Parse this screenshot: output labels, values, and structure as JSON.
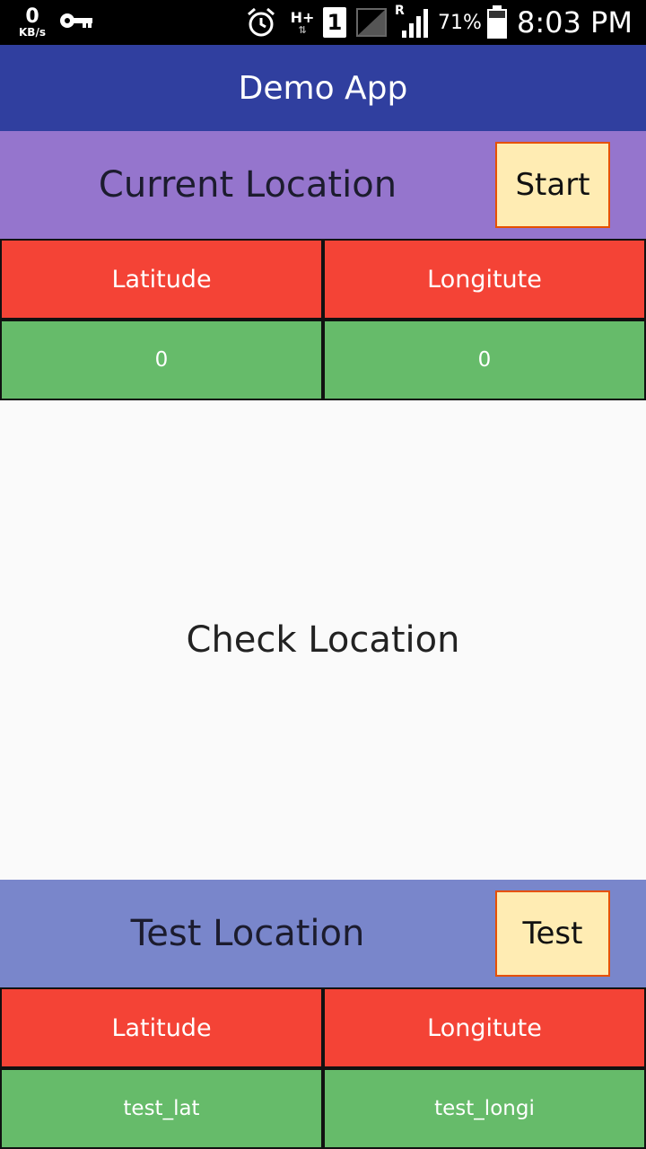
{
  "status_bar": {
    "data_rate_value": "0",
    "data_rate_unit": "KB/s",
    "network_type": "H+",
    "sim_slot": "1",
    "roaming": "R",
    "battery_percent": "71%",
    "time": "8:03 PM",
    "icons": [
      "vpn-key-icon",
      "alarm-icon",
      "sim-icon",
      "signal-icon",
      "battery-icon"
    ]
  },
  "app_bar": {
    "title": "Demo App",
    "color": "#303f9f"
  },
  "current_location": {
    "title": "Current Location",
    "button_label": "Start",
    "header_color": "#9575cd",
    "latitude_label": "Latitude",
    "longitude_label": "Longitute",
    "latitude_value": "0",
    "longitude_value": "0"
  },
  "check_location": {
    "label": "Check Location"
  },
  "test_location": {
    "title": "Test Location",
    "button_label": "Test",
    "header_color": "#7986cb",
    "latitude_label": "Latitude",
    "longitude_label": "Longitute",
    "latitude_value": "test_lat",
    "longitude_value": "test_longi"
  },
  "colors": {
    "head_cell": "#f44336",
    "value_cell": "#66bb6a",
    "button_bg": "#ffecb3"
  }
}
